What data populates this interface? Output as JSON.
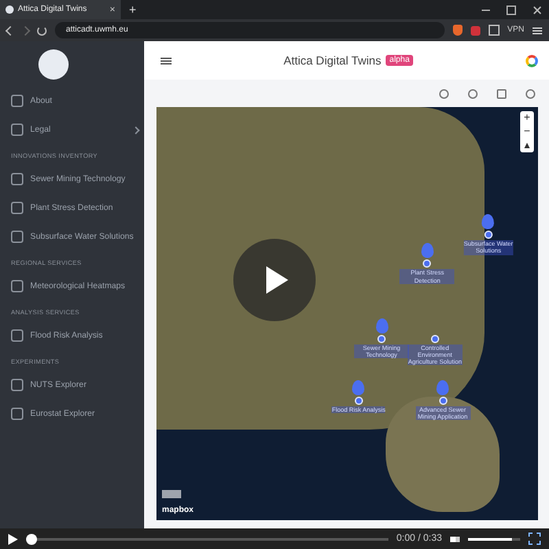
{
  "browser": {
    "tab": {
      "title": "Attica Digital Twins",
      "close": "×"
    },
    "new_tab": "+",
    "url": "atticadt.uwmh.eu",
    "vpn": "VPN"
  },
  "sidebar": {
    "items": [
      {
        "kind": "item",
        "label": "About",
        "chevron": false
      },
      {
        "kind": "item",
        "label": "Legal",
        "chevron": true
      },
      {
        "kind": "section",
        "label": "INNOVATIONS INVENTORY"
      },
      {
        "kind": "item",
        "label": "Sewer Mining Technology",
        "chevron": false
      },
      {
        "kind": "item",
        "label": "Plant Stress Detection",
        "chevron": false
      },
      {
        "kind": "item",
        "label": "Subsurface Water Solutions",
        "chevron": false
      },
      {
        "kind": "section",
        "label": "REGIONAL SERVICES"
      },
      {
        "kind": "item",
        "label": "Meteorological Heatmaps",
        "chevron": false
      },
      {
        "kind": "section",
        "label": "ANALYSIS SERVICES"
      },
      {
        "kind": "item",
        "label": "Flood Risk Analysis",
        "chevron": false
      },
      {
        "kind": "section",
        "label": "EXPERIMENTS"
      },
      {
        "kind": "item",
        "label": "NUTS Explorer",
        "chevron": false
      },
      {
        "kind": "item",
        "label": "Eurostat Explorer",
        "chevron": false
      }
    ]
  },
  "header": {
    "title": "Attica Digital Twins",
    "badge": "alpha"
  },
  "map": {
    "zoom_in": "+",
    "zoom_out": "−",
    "attribution": "mapbox",
    "markers": [
      {
        "label": "Plant Stress Detection",
        "pin": true
      },
      {
        "label": "Subsurface Water Solutions",
        "pin": true
      },
      {
        "label": "Sewer Mining Technology",
        "pin": true
      },
      {
        "label": "Controlled Environment Agriculture Solution",
        "pin": false
      },
      {
        "label": "Flood Risk Analysis",
        "pin": true
      },
      {
        "label": "Advanced Sewer Mining Application",
        "pin": true
      }
    ]
  },
  "video": {
    "progress": {
      "level": 0
    },
    "time": "0:00 / 0:33",
    "volume": {
      "level": 0.85
    }
  }
}
